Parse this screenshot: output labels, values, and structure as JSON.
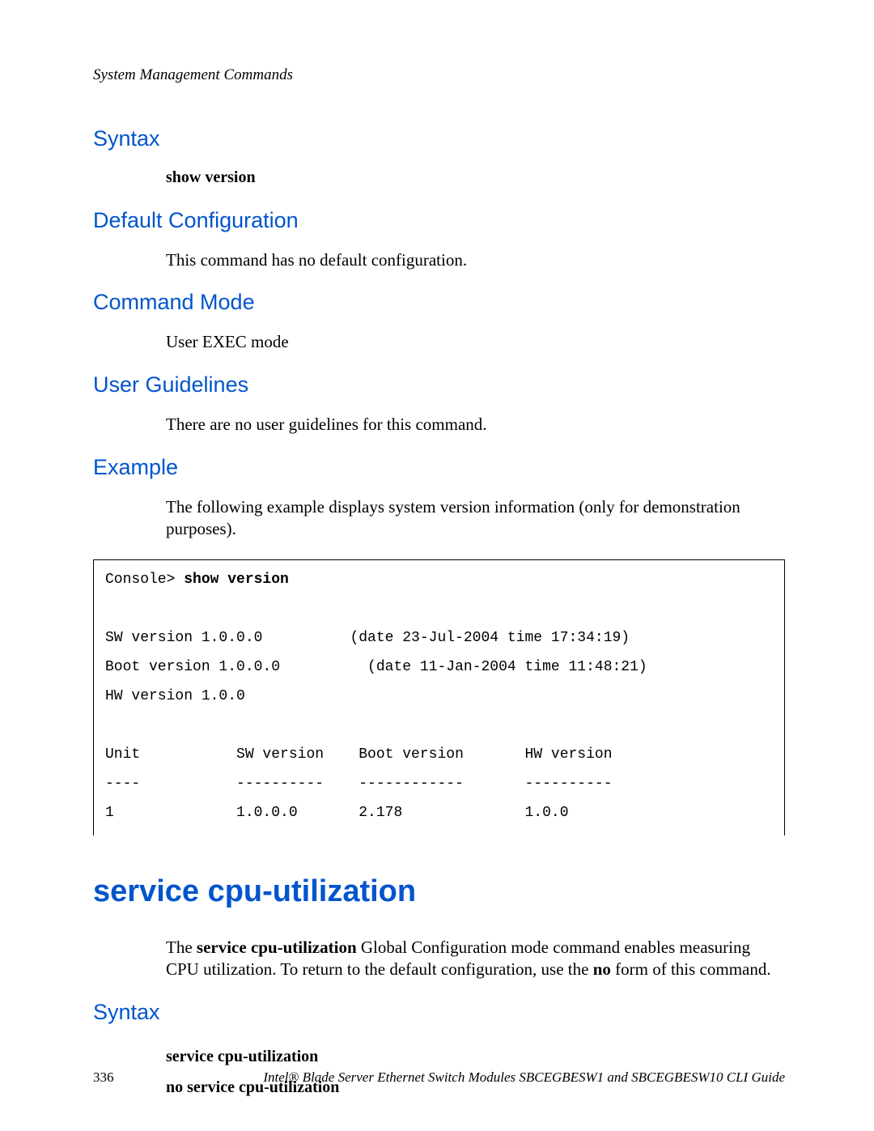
{
  "header": {
    "running": "System Management Commands"
  },
  "sections": {
    "syntax1": "Syntax",
    "show_version_cmd": "show version",
    "default_config": "Default Configuration",
    "default_config_body": "This command has no default configuration.",
    "command_mode": "Command Mode",
    "command_mode_body": "User EXEC mode",
    "user_guidelines": "User Guidelines",
    "user_guidelines_body": "There are no user guidelines for this command.",
    "example": "Example",
    "example_body": "The following example displays system version information (only for demonstration purposes).",
    "cmd_title": "service cpu-utilization",
    "cmd_desc_pre": "The ",
    "cmd_desc_bold1": "service cpu-utilization",
    "cmd_desc_mid": " Global Configuration mode command enables measuring CPU utilization. To return to the default configuration, use the ",
    "cmd_desc_bold2": "no",
    "cmd_desc_post": " form of this command.",
    "syntax2": "Syntax",
    "syntax2_line1": "service cpu-utilization",
    "syntax2_line2": "no service cpu-utilization"
  },
  "code": {
    "prompt": "Console> ",
    "command": "show version",
    "body": "\n\nSW version 1.0.0.0          (date 23-Jul-2004 time 17:34:19)\nBoot version 1.0.0.0          (date 11-Jan-2004 time 11:48:21)\nHW version 1.0.0\n\nUnit           SW version    Boot version       HW version\n----           ----------    ------------       ----------\n1              1.0.0.0       2.178              1.0.0"
  },
  "footer": {
    "page": "336",
    "title": "Intel® Blade Server Ethernet Switch Modules SBCEGBESW1 and SBCEGBESW10 CLI Guide"
  }
}
